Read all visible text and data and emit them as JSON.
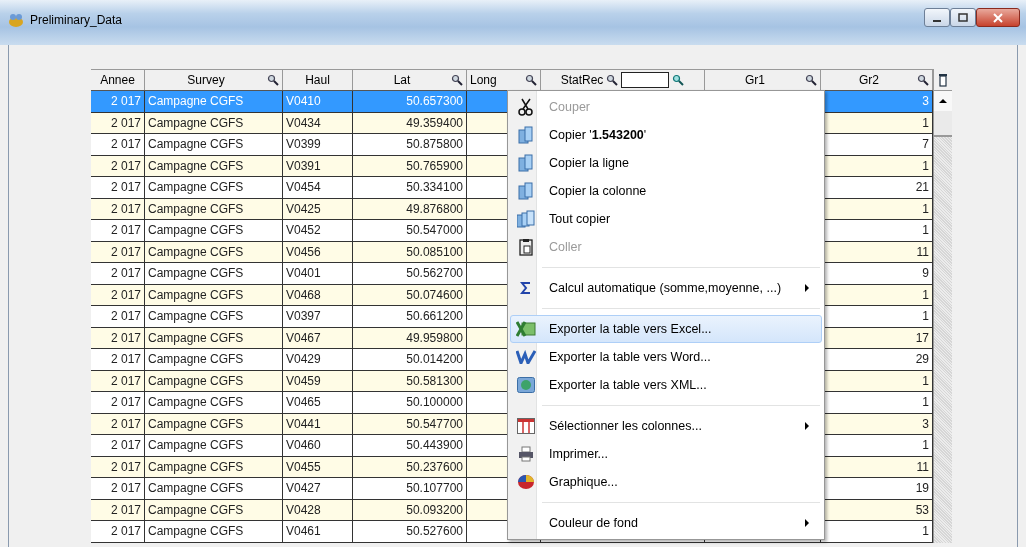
{
  "window": {
    "title": "Preliminary_Data"
  },
  "table": {
    "columns": [
      {
        "label": "Annee",
        "filter": false,
        "filter_field": false
      },
      {
        "label": "Survey",
        "filter": true,
        "filter_field": false
      },
      {
        "label": "Haul",
        "filter": false,
        "filter_field": false
      },
      {
        "label": "Lat",
        "filter": true,
        "filter_field": false
      },
      {
        "label": "Long",
        "filter": true,
        "filter_field": false
      },
      {
        "label": "StatRec",
        "filter": true,
        "filter_field": true
      },
      {
        "label": "Gr1",
        "filter": true,
        "filter_field": false
      },
      {
        "label": "Gr2",
        "filter": true,
        "filter_field": false
      }
    ],
    "rows": [
      {
        "selected": true,
        "annee": "2 017",
        "survey": "Campagne CGFS",
        "haul": "V0410",
        "lat": "50.657300",
        "gr2": "3"
      },
      {
        "selected": false,
        "annee": "2 017",
        "survey": "Campagne CGFS",
        "haul": "V0434",
        "lat": "49.359400",
        "gr2": "1"
      },
      {
        "selected": false,
        "annee": "2 017",
        "survey": "Campagne CGFS",
        "haul": "V0399",
        "lat": "50.875800",
        "gr2": "7"
      },
      {
        "selected": false,
        "annee": "2 017",
        "survey": "Campagne CGFS",
        "haul": "V0391",
        "lat": "50.765900",
        "gr2": "1"
      },
      {
        "selected": false,
        "annee": "2 017",
        "survey": "Campagne CGFS",
        "haul": "V0454",
        "lat": "50.334100",
        "gr2": "21"
      },
      {
        "selected": false,
        "annee": "2 017",
        "survey": "Campagne CGFS",
        "haul": "V0425",
        "lat": "49.876800",
        "gr2": "1"
      },
      {
        "selected": false,
        "annee": "2 017",
        "survey": "Campagne CGFS",
        "haul": "V0452",
        "lat": "50.547000",
        "gr2": "1"
      },
      {
        "selected": false,
        "annee": "2 017",
        "survey": "Campagne CGFS",
        "haul": "V0456",
        "lat": "50.085100",
        "gr2": "11"
      },
      {
        "selected": false,
        "annee": "2 017",
        "survey": "Campagne CGFS",
        "haul": "V0401",
        "lat": "50.562700",
        "gr2": "9"
      },
      {
        "selected": false,
        "annee": "2 017",
        "survey": "Campagne CGFS",
        "haul": "V0468",
        "lat": "50.074600",
        "gr2": "1"
      },
      {
        "selected": false,
        "annee": "2 017",
        "survey": "Campagne CGFS",
        "haul": "V0397",
        "lat": "50.661200",
        "gr2": "1"
      },
      {
        "selected": false,
        "annee": "2 017",
        "survey": "Campagne CGFS",
        "haul": "V0467",
        "lat": "49.959800",
        "gr2": "17"
      },
      {
        "selected": false,
        "annee": "2 017",
        "survey": "Campagne CGFS",
        "haul": "V0429",
        "lat": "50.014200",
        "gr2": "29"
      },
      {
        "selected": false,
        "annee": "2 017",
        "survey": "Campagne CGFS",
        "haul": "V0459",
        "lat": "50.581300",
        "gr2": "1"
      },
      {
        "selected": false,
        "annee": "2 017",
        "survey": "Campagne CGFS",
        "haul": "V0465",
        "lat": "50.100000",
        "gr2": "1"
      },
      {
        "selected": false,
        "annee": "2 017",
        "survey": "Campagne CGFS",
        "haul": "V0441",
        "lat": "50.547700",
        "gr2": "3"
      },
      {
        "selected": false,
        "annee": "2 017",
        "survey": "Campagne CGFS",
        "haul": "V0460",
        "lat": "50.443900",
        "gr2": "1"
      },
      {
        "selected": false,
        "annee": "2 017",
        "survey": "Campagne CGFS",
        "haul": "V0455",
        "lat": "50.237600",
        "gr2": "11"
      },
      {
        "selected": false,
        "annee": "2 017",
        "survey": "Campagne CGFS",
        "haul": "V0427",
        "lat": "50.107700",
        "gr2": "19"
      },
      {
        "selected": false,
        "annee": "2 017",
        "survey": "Campagne CGFS",
        "haul": "V0428",
        "lat": "50.093200",
        "gr2": "53"
      },
      {
        "selected": false,
        "annee": "2 017",
        "survey": "Campagne CGFS",
        "haul": "V0461",
        "lat": "50.527600",
        "gr2": "1"
      }
    ]
  },
  "context_menu": {
    "items": [
      {
        "kind": "item",
        "label": "Couper",
        "disabled": true,
        "submenu": false,
        "selected": false
      },
      {
        "kind": "item",
        "label": "Copier '**1.543200**'",
        "disabled": false,
        "submenu": false,
        "selected": false
      },
      {
        "kind": "item",
        "label": "Copier la ligne",
        "disabled": false,
        "submenu": false,
        "selected": false
      },
      {
        "kind": "item",
        "label": "Copier la colonne",
        "disabled": false,
        "submenu": false,
        "selected": false
      },
      {
        "kind": "item",
        "label": "Tout copier",
        "disabled": false,
        "submenu": false,
        "selected": false
      },
      {
        "kind": "item",
        "label": "Coller",
        "disabled": true,
        "submenu": false,
        "selected": false
      },
      {
        "kind": "separator"
      },
      {
        "kind": "item",
        "label": "Calcul automatique (somme,moyenne, ...)",
        "disabled": false,
        "submenu": true,
        "selected": false
      },
      {
        "kind": "separator"
      },
      {
        "kind": "item",
        "label": "Exporter la table vers Excel...",
        "disabled": false,
        "submenu": false,
        "selected": true
      },
      {
        "kind": "item",
        "label": "Exporter la table vers Word...",
        "disabled": false,
        "submenu": false,
        "selected": false
      },
      {
        "kind": "item",
        "label": "Exporter la table vers XML...",
        "disabled": false,
        "submenu": false,
        "selected": false
      },
      {
        "kind": "separator"
      },
      {
        "kind": "item",
        "label": "Sélectionner les colonnes...",
        "disabled": false,
        "submenu": true,
        "selected": false
      },
      {
        "kind": "item",
        "label": "Imprimer...",
        "disabled": false,
        "submenu": false,
        "selected": false
      },
      {
        "kind": "item",
        "label": "Graphique...",
        "disabled": false,
        "submenu": false,
        "selected": false
      },
      {
        "kind": "separator"
      },
      {
        "kind": "item",
        "label": "Couleur de fond",
        "disabled": false,
        "submenu": true,
        "selected": false
      }
    ]
  }
}
